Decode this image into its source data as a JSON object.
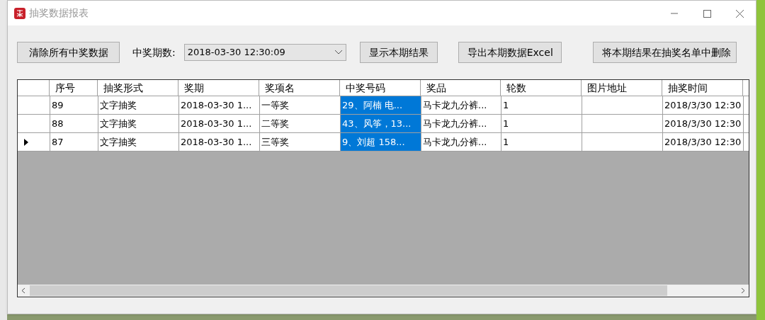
{
  "window": {
    "title": "抽奖数据报表"
  },
  "toolbar": {
    "clear_button": "清除所有中奖数据",
    "period_label": "中奖期数:",
    "period_value": "2018-03-30 12:30:09",
    "show_button": "显示本期结果",
    "export_button": "导出本期数据Excel",
    "delete_button": "将本期结果在抽奖名单中删除"
  },
  "table": {
    "columns": [
      "序号",
      "抽奖形式",
      "奖期",
      "奖项名",
      "中奖号码",
      "奖品",
      "轮数",
      "图片地址",
      "抽奖时间"
    ],
    "rows": [
      {
        "current": false,
        "cells": [
          {
            "text": "89",
            "selected": false
          },
          {
            "text": "文字抽奖",
            "selected": false
          },
          {
            "text": "2018-03-30 1...",
            "selected": false
          },
          {
            "text": "一等奖",
            "selected": false
          },
          {
            "text": "29、阿楠 电...",
            "selected": true
          },
          {
            "text": "马卡龙九分裤...",
            "selected": false
          },
          {
            "text": "1",
            "selected": false
          },
          {
            "text": "",
            "selected": false
          },
          {
            "text": "2018/3/30 12:30",
            "selected": false
          }
        ]
      },
      {
        "current": false,
        "cells": [
          {
            "text": "88",
            "selected": false
          },
          {
            "text": "文字抽奖",
            "selected": false
          },
          {
            "text": "2018-03-30 1...",
            "selected": false
          },
          {
            "text": "二等奖",
            "selected": false
          },
          {
            "text": "43、风筝，13...",
            "selected": true
          },
          {
            "text": "马卡龙九分裤...",
            "selected": false
          },
          {
            "text": "1",
            "selected": false
          },
          {
            "text": "",
            "selected": false
          },
          {
            "text": "2018/3/30 12:30",
            "selected": false
          }
        ]
      },
      {
        "current": true,
        "cells": [
          {
            "text": "87",
            "selected": false
          },
          {
            "text": "文字抽奖",
            "selected": false
          },
          {
            "text": "2018-03-30 1...",
            "selected": false
          },
          {
            "text": "三等奖",
            "selected": false
          },
          {
            "text": "9、刘超  158...",
            "selected": true
          },
          {
            "text": "马卡龙九分裤...",
            "selected": false
          },
          {
            "text": "1",
            "selected": false
          },
          {
            "text": "",
            "selected": false
          },
          {
            "text": "2018/3/30 12:30",
            "selected": false
          }
        ]
      }
    ]
  }
}
